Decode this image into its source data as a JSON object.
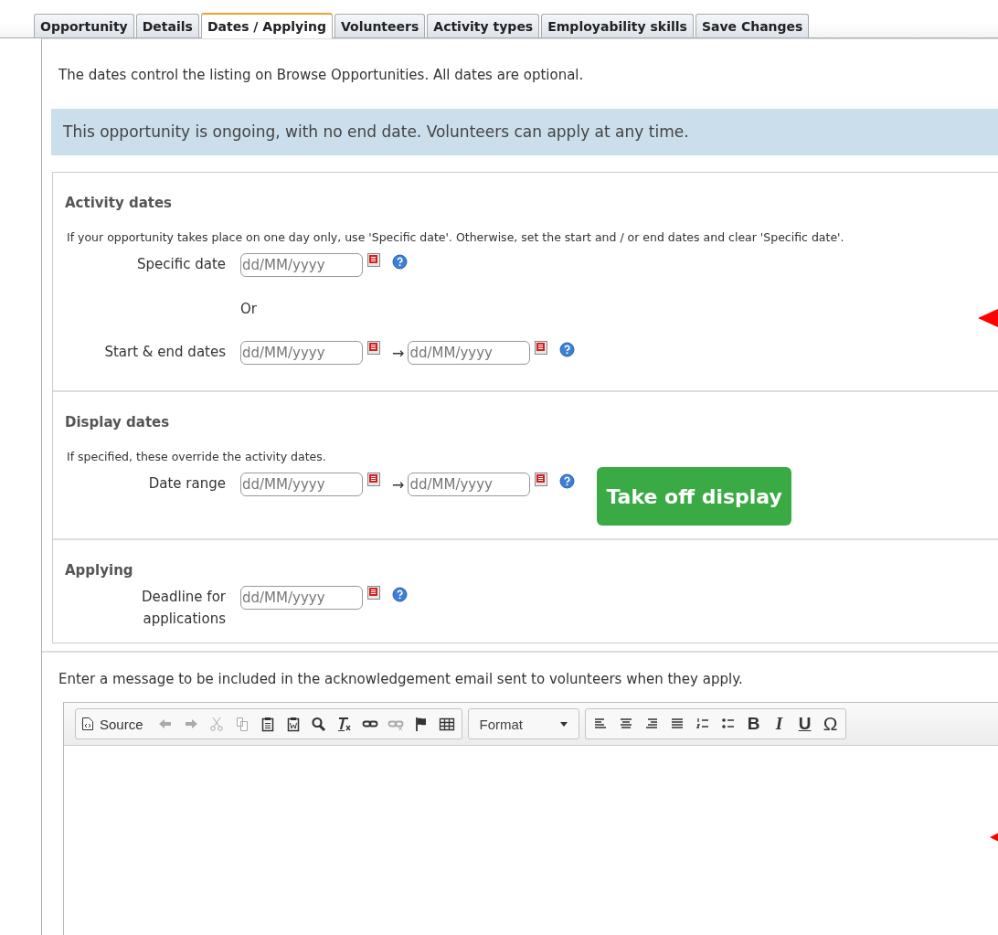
{
  "tabs": [
    {
      "label": "Opportunity",
      "selected": false
    },
    {
      "label": "Details",
      "selected": false
    },
    {
      "label": "Dates / Applying",
      "selected": true
    },
    {
      "label": "Volunteers",
      "selected": false
    },
    {
      "label": "Activity types",
      "selected": false
    },
    {
      "label": "Employability skills",
      "selected": false
    },
    {
      "label": "Save Changes",
      "selected": false
    }
  ],
  "intro": "The dates control the listing on Browse Opportunities. All dates are optional.",
  "notice": "This opportunity is ongoing, with no end date. Volunteers can apply at any time.",
  "sections": [
    {
      "heading": "Activity dates",
      "note": "If your opportunity takes place on one day only, use 'Specific date'. Otherwise, set the start and / or end dates and clear 'Specific date'.",
      "rows": [
        {
          "kind": "fields",
          "label": "Specific date",
          "fields": [
            {
              "placeholder": "dd/MM/yyyy"
            }
          ]
        },
        {
          "kind": "or",
          "text": "Or"
        },
        {
          "kind": "fields",
          "label": "Start & end dates",
          "separator": "→",
          "fields": [
            {
              "placeholder": "dd/MM/yyyy"
            },
            {
              "placeholder": "dd/MM/yyyy"
            }
          ]
        }
      ]
    },
    {
      "heading": "Display dates",
      "note": "If specified, these override the activity dates.",
      "rows": [
        {
          "kind": "fields",
          "label": "Date range",
          "separator": "→",
          "fields": [
            {
              "placeholder": "dd/MM/yyyy"
            },
            {
              "placeholder": "dd/MM/yyyy"
            }
          ],
          "button": "Take off display"
        }
      ]
    },
    {
      "heading": "Applying",
      "rows": [
        {
          "kind": "fields",
          "label": "Deadline for applications",
          "fields": [
            {
              "placeholder": "dd/MM/yyyy"
            }
          ]
        }
      ]
    }
  ],
  "message_prompt": "Enter a message to be included in the acknowledgement email sent to volunteers when they apply.",
  "toolbar": [
    [
      {
        "kind": "source",
        "label": "Source",
        "disabled": false
      },
      {
        "kind": "undo",
        "disabled": true
      },
      {
        "kind": "redo",
        "disabled": true
      },
      {
        "kind": "cut",
        "disabled": true
      },
      {
        "kind": "copy",
        "disabled": true
      },
      {
        "kind": "paste",
        "disabled": false
      },
      {
        "kind": "paste-word",
        "disabled": false
      },
      {
        "kind": "find",
        "disabled": false
      },
      {
        "kind": "remove-format",
        "disabled": false
      },
      {
        "kind": "link",
        "disabled": false
      },
      {
        "kind": "unlink",
        "disabled": true
      },
      {
        "kind": "anchor",
        "disabled": false
      },
      {
        "kind": "table",
        "disabled": false
      }
    ],
    [
      {
        "kind": "combo",
        "label": "Format",
        "disabled": false
      }
    ],
    [
      {
        "kind": "align-left",
        "disabled": false
      },
      {
        "kind": "align-center",
        "disabled": false
      },
      {
        "kind": "align-right",
        "disabled": false
      },
      {
        "kind": "justify",
        "disabled": false
      },
      {
        "kind": "numbered-list",
        "disabled": false
      },
      {
        "kind": "bulleted-list",
        "disabled": false
      },
      {
        "kind": "bold",
        "text": "B",
        "disabled": false
      },
      {
        "kind": "italic",
        "text": "I",
        "disabled": false
      },
      {
        "kind": "underline",
        "text": "U",
        "disabled": false
      },
      {
        "kind": "char",
        "text": "Ω",
        "disabled": false
      }
    ]
  ]
}
